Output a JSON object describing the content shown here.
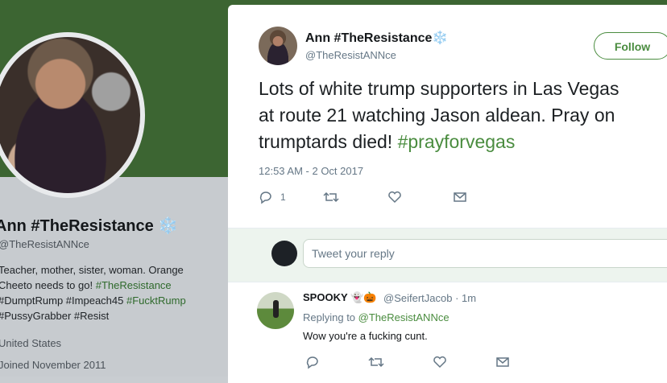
{
  "background_profile": {
    "name": "Ann #TheResistance",
    "name_emoji": "❄️",
    "handle": "@TheResistANNce",
    "bio_lines": [
      "Teacher, mother, sister, woman. Orange",
      "Cheeto needs to go!",
      "#DumptRump #Impeach45",
      "#PussyGrabber #Resist"
    ],
    "bio_tags": [
      "#TheResistance",
      "#FucktRump"
    ],
    "location": "United States",
    "joined": "Joined November 2011"
  },
  "tweet": {
    "author_name": "Ann #TheResistance",
    "author_emoji": "❄️",
    "author_handle": "@TheResistANNce",
    "follow_label": "Follow",
    "text_lines": [
      "Lots of white trump supporters in Las Vegas",
      "at route 21 watching Jason aldean. Pray on",
      "trumptards died!"
    ],
    "hashtag": "#prayforvegas",
    "timestamp": "12:53 AM - 2 Oct 2017",
    "reply_count": "1"
  },
  "reply_box": {
    "placeholder": "Tweet your reply"
  },
  "reply": {
    "author_name": "SPOOKY",
    "author_emoji": "👻🎃",
    "author_handle": "@SeifertJacob · 1m",
    "replying_prefix": "Replying to",
    "replying_to": "@TheResistANNce",
    "text": "Wow you're a fucking cunt."
  },
  "colors": {
    "accent": "#4a8c3f",
    "banner": "#3c6532",
    "text_primary": "#14171a",
    "text_secondary": "#657786"
  }
}
